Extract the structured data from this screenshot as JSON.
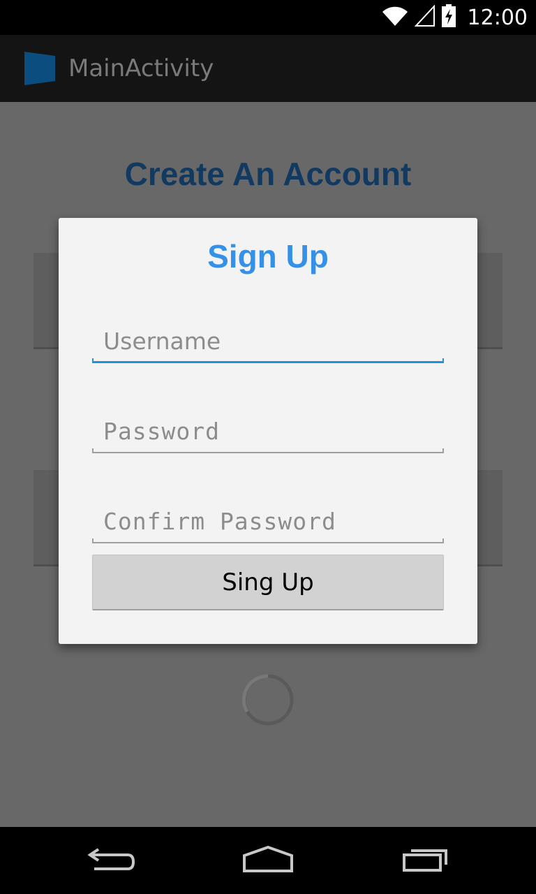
{
  "status_bar": {
    "time": "12:00",
    "icons": [
      "wifi-icon",
      "cell-signal-icon",
      "battery-charging-icon"
    ]
  },
  "action_bar": {
    "title": "MainActivity",
    "app_icon": "app-logo-icon"
  },
  "background_screen": {
    "heading": "Create An Account"
  },
  "dialog": {
    "title": "Sign Up",
    "fields": {
      "username_placeholder": "Username",
      "password_placeholder": "Password",
      "confirm_placeholder": "Confirm Password"
    },
    "button_label": "Sing Up"
  },
  "nav_bar": {
    "icons": [
      "back-icon",
      "home-icon",
      "recents-icon"
    ]
  },
  "colors": {
    "dialog_title": "#3591e8",
    "heading": "#12395f",
    "focus_underline": "#1a95d8"
  }
}
